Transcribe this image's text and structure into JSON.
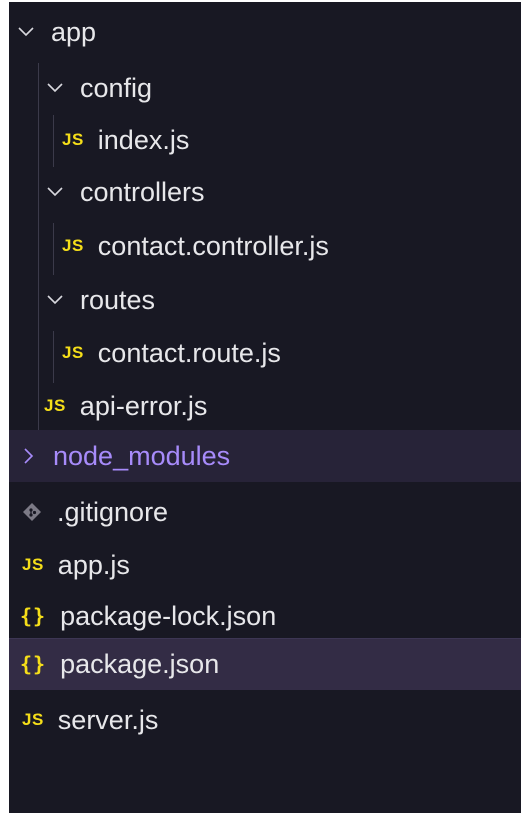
{
  "colors": {
    "background": "#181823",
    "text": "#e7e7ea",
    "js_icon": "#f5de19",
    "json_icon": "#f5de19",
    "ignored_folder": "#a78bfa",
    "hover_row": "#272338",
    "selected_row": "#332c45"
  },
  "explorer": {
    "items": [
      {
        "label": "app",
        "type": "folder",
        "expanded": true,
        "icon": "chevron-down-icon"
      },
      {
        "label": "config",
        "type": "folder",
        "expanded": true,
        "icon": "chevron-down-icon"
      },
      {
        "label": "index.js",
        "type": "file",
        "icon": "javascript-file-icon",
        "icon_text": "JS"
      },
      {
        "label": "controllers",
        "type": "folder",
        "expanded": true,
        "icon": "chevron-down-icon"
      },
      {
        "label": "contact.controller.js",
        "type": "file",
        "icon": "javascript-file-icon",
        "icon_text": "JS"
      },
      {
        "label": "routes",
        "type": "folder",
        "expanded": true,
        "icon": "chevron-down-icon"
      },
      {
        "label": "contact.route.js",
        "type": "file",
        "icon": "javascript-file-icon",
        "icon_text": "JS"
      },
      {
        "label": "api-error.js",
        "type": "file",
        "icon": "javascript-file-icon",
        "icon_text": "JS"
      },
      {
        "label": "node_modules",
        "type": "folder",
        "expanded": false,
        "icon": "chevron-right-icon",
        "git_ignored": true,
        "hovered": true
      },
      {
        "label": ".gitignore",
        "type": "file",
        "icon": "git-diamond-icon"
      },
      {
        "label": "app.js",
        "type": "file",
        "icon": "javascript-file-icon",
        "icon_text": "JS"
      },
      {
        "label": "package-lock.json",
        "type": "file",
        "icon": "json-braces-icon",
        "icon_text": "{}"
      },
      {
        "label": "package.json",
        "type": "file",
        "icon": "json-braces-icon",
        "icon_text": "{}",
        "selected": true
      },
      {
        "label": "server.js",
        "type": "file",
        "icon": "javascript-file-icon",
        "icon_text": "JS"
      }
    ]
  }
}
